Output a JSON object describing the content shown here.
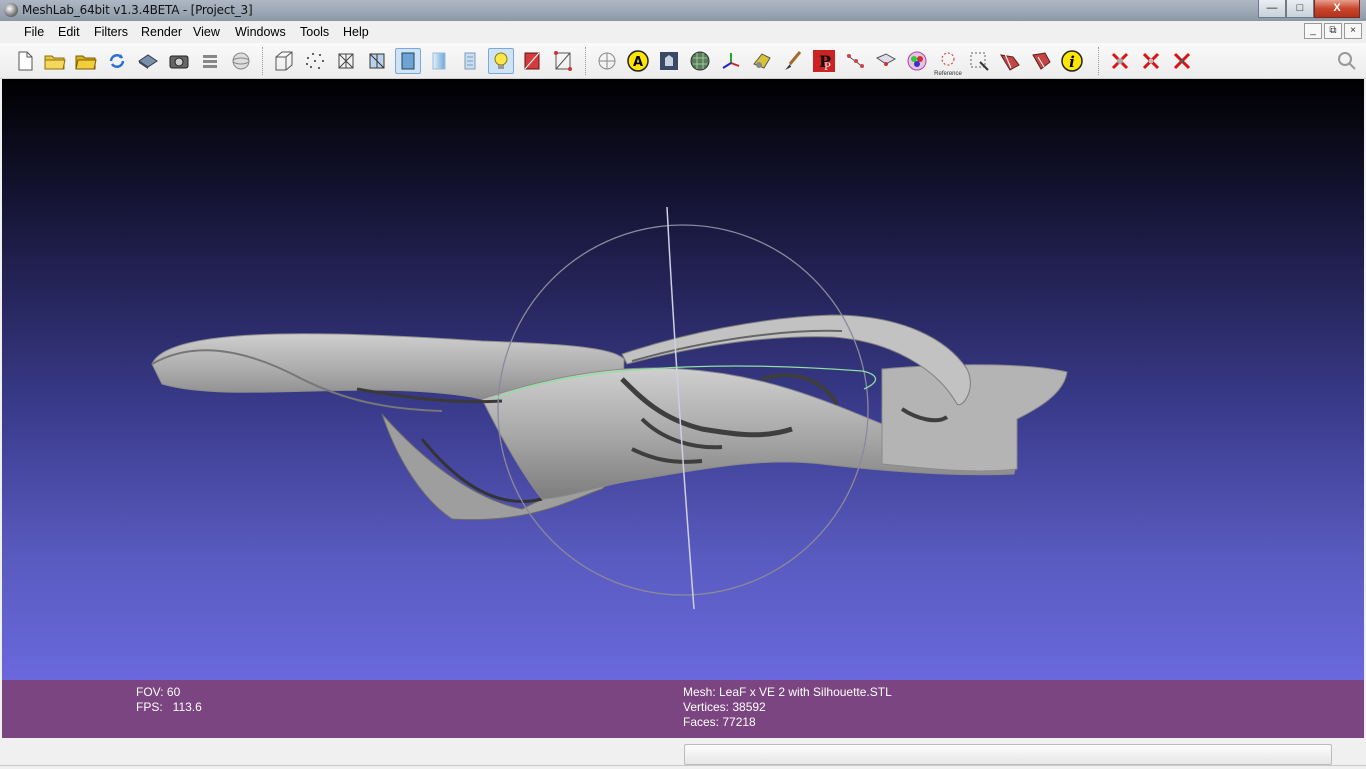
{
  "window": {
    "title": "MeshLab_64bit v1.3.4BETA - [Project_3]",
    "minimize": "—",
    "maximize": "□",
    "close": "X"
  },
  "menu": {
    "items": [
      "File",
      "Edit",
      "Filters",
      "Render",
      "View",
      "Windows",
      "Tools",
      "Help"
    ]
  },
  "mdi": {
    "minimize": "_",
    "restore": "⧉",
    "close": "×"
  },
  "toolbar": {
    "icons": [
      "new-document-icon",
      "open-folder-icon",
      "open-project-icon",
      "reload-icon",
      "save-icon",
      "snapshot-icon",
      "layers-icon",
      "trackball-icon",
      "bounding-box-icon",
      "points-icon",
      "wireframe-icon",
      "hidden-lines-icon",
      "flat-icon",
      "smooth-icon",
      "texture-icon",
      "light-icon",
      "color-faces-icon",
      "color-vertices-icon",
      "grid-icon",
      "annotation-icon",
      "reference-icon",
      "mesh-layers-icon",
      "axis-icon",
      "align-icon",
      "paint-brush-icon",
      "pick-points-icon",
      "measure-icon",
      "select-icon",
      "color-select-icon",
      "select-region-icon",
      "reference-points-icon",
      "select-vertex-icon",
      "select-faces-icon",
      "select-connected-icon",
      "info-icon",
      "delete-selected-icon",
      "delete-faces-icon",
      "delete-vertices-icon",
      "search-icon"
    ],
    "reference_label": "Reference"
  },
  "viewport": {
    "fov_label": "FOV: 60",
    "fps_label": "FPS:   113.6",
    "mesh_label": "Mesh: LeaF x VE 2 with Silhouette.STL",
    "vertices_label": "Vertices: 38592",
    "faces_label": "Faces: 77218"
  },
  "colors": {
    "info_bar": "#7b4581",
    "viewport_top": "#000000",
    "viewport_bottom": "#6a68dc",
    "mesh": "#a8a8a8",
    "trackball_ring": "#7a7a8a"
  }
}
